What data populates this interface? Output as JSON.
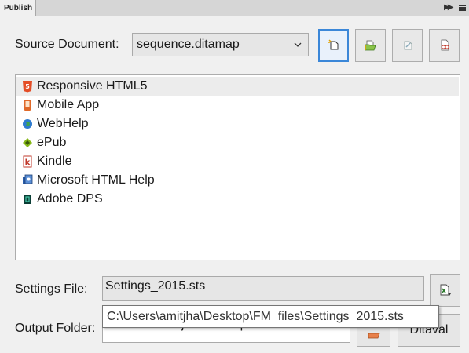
{
  "panel": {
    "tab_label": "Publish"
  },
  "source": {
    "label": "Source Document:",
    "selected": "sequence.ditamap"
  },
  "toolbar": {
    "buttons": [
      {
        "icon": "new-settings-icon",
        "active": true
      },
      {
        "icon": "open-folder-icon",
        "active": false
      },
      {
        "icon": "edit-settings-icon",
        "active": false,
        "disabled": true
      },
      {
        "icon": "glasses-icon",
        "active": false
      }
    ]
  },
  "outputs": [
    {
      "label": "Responsive HTML5",
      "icon": "html5-icon",
      "selected": true
    },
    {
      "label": "Mobile App",
      "icon": "mobile-app-icon",
      "selected": false
    },
    {
      "label": "WebHelp",
      "icon": "webhelp-globe-icon",
      "selected": false
    },
    {
      "label": "ePub",
      "icon": "epub-icon",
      "selected": false
    },
    {
      "label": "Kindle",
      "icon": "kindle-icon",
      "selected": false
    },
    {
      "label": "Microsoft HTML Help",
      "icon": "html-help-icon",
      "selected": false
    },
    {
      "label": "Adobe DPS",
      "icon": "adobe-dps-icon",
      "selected": false
    }
  ],
  "settings": {
    "label": "Settings File:",
    "value": "Settings_2015.sts",
    "tooltip": "C:\\Users\\amitjha\\Desktop\\FM_files\\Settings_2015.sts"
  },
  "output_folder": {
    "label": "Output Folder:",
    "value_partial": "C:\\Users\\amitjha\\FMOutput"
  },
  "ditaval_button": "Ditaval",
  "colors": {
    "accent": "#3b87d8",
    "background": "#f0f0f0"
  }
}
